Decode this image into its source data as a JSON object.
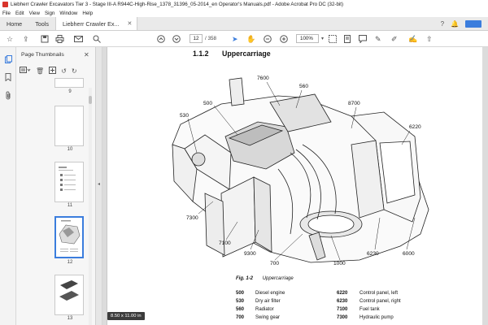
{
  "window": {
    "title": "Liebherr Crawler Excavators Tier 3 - Stage III-A  R944C-High-Rise_1378_31396_05-2014_en Operator's Manuals.pdf - Adobe Acrobat Pro DC (32-bit)"
  },
  "menu": [
    "File",
    "Edit",
    "View",
    "Sign",
    "Window",
    "Help"
  ],
  "tabs": {
    "home": "Home",
    "tools": "Tools",
    "document": "Liebherr Crawler Ex..."
  },
  "toolbar": {
    "current_page": "12",
    "page_count": "/ 358",
    "zoom": "100%"
  },
  "thumbnail_panel": {
    "title": "Page Thumbnails",
    "pages": [
      {
        "label": "9"
      },
      {
        "label": "10"
      },
      {
        "label": "11"
      },
      {
        "label": "12"
      },
      {
        "label": "13"
      }
    ]
  },
  "document": {
    "section_number": "1.1.2",
    "section_title": "Uppercarriage",
    "callouts": {
      "c7600": "7600",
      "c560": "560",
      "c500": "500",
      "c530": "530",
      "c8700": "8700",
      "c6220": "6220",
      "c7300": "7300",
      "c7100": "7100",
      "c9300": "9300",
      "c700": "700",
      "c1000": "1000",
      "c6230": "6230",
      "c6000": "6000"
    },
    "figure_label": "Fig. 1-2",
    "figure_caption": "Uppercarriage",
    "legend_left": [
      {
        "code": "500",
        "text": "Diesel engine"
      },
      {
        "code": "530",
        "text": "Dry air filter"
      },
      {
        "code": "560",
        "text": "Radiator"
      },
      {
        "code": "700",
        "text": "Swing gear"
      }
    ],
    "legend_right": [
      {
        "code": "6220",
        "text": "Control panel, left"
      },
      {
        "code": "6230",
        "text": "Control panel, right"
      },
      {
        "code": "7100",
        "text": "Fuel tank"
      },
      {
        "code": "7300",
        "text": "Hydraulic pump"
      }
    ]
  },
  "page_size_badge": "8.50 x 11.00 in",
  "colors": {
    "accent": "#3b7ddd",
    "acrobat_red": "#d9342b"
  }
}
